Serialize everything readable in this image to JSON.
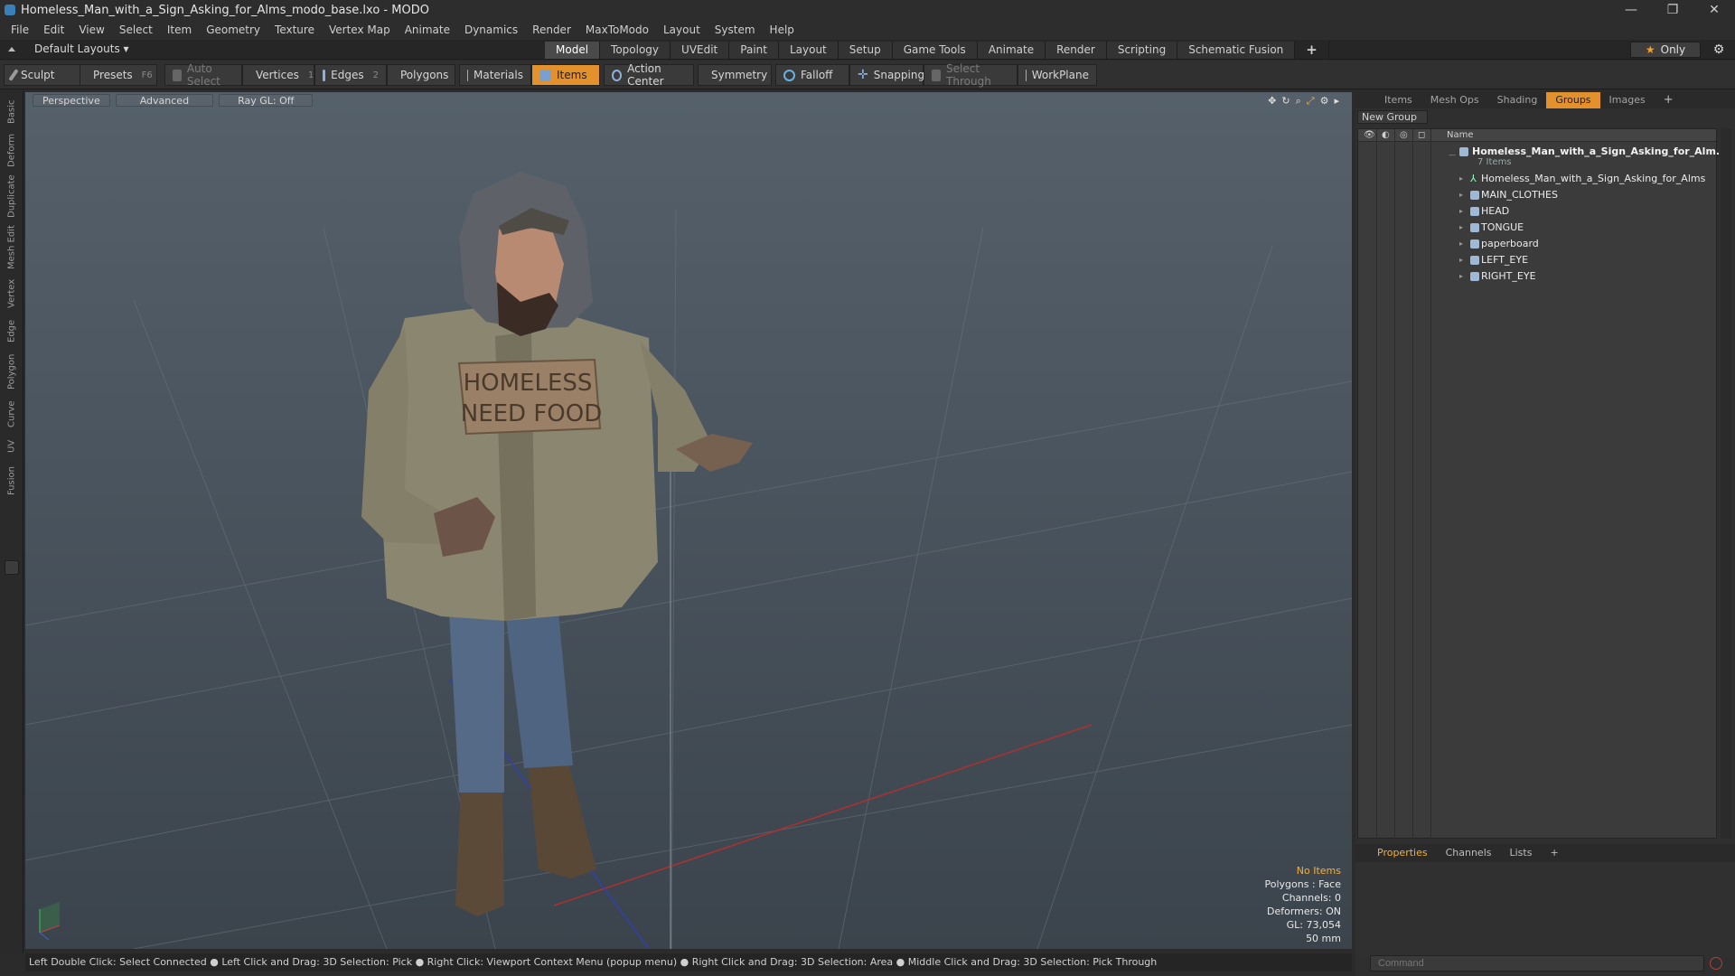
{
  "window": {
    "title": "Homeless_Man_with_a_Sign_Asking_for_Alms_modo_base.lxo - MODO",
    "controls": [
      "—",
      "❐",
      "✕"
    ]
  },
  "menu": [
    "File",
    "Edit",
    "View",
    "Select",
    "Item",
    "Geometry",
    "Texture",
    "Vertex Map",
    "Animate",
    "Dynamics",
    "Render",
    "MaxToModo",
    "Layout",
    "System",
    "Help"
  ],
  "layout_bar": {
    "layout_select": "Default Layouts ▾",
    "tabs": [
      "Model",
      "Topology",
      "UVEdit",
      "Paint",
      "Layout",
      "Setup",
      "Game Tools",
      "Animate",
      "Render",
      "Scripting",
      "Schematic Fusion"
    ],
    "active_tab": "Model",
    "add_tab": "+",
    "only_label": "Only",
    "star": "★"
  },
  "toolbar": {
    "sculpt": "Sculpt",
    "presets": "Presets",
    "presets_key": "F6",
    "auto_select": "Auto Select",
    "vertices": "Vertices",
    "vertices_key": "1",
    "edges": "Edges",
    "edges_key": "2",
    "polygons": "Polygons",
    "materials": "Materials",
    "items": "Items",
    "action_center": "Action Center",
    "symmetry": "Symmetry",
    "falloff": "Falloff",
    "snapping": "Snapping",
    "select_through": "Select Through",
    "workplane": "WorkPlane"
  },
  "left_strip": [
    "Basic",
    "Deform",
    "Duplicate",
    "Mesh Edit",
    "Vertex",
    "Edge",
    "Polygon",
    "Curve",
    "UV",
    "Fusion"
  ],
  "viewport": {
    "view_mode": "Perspective",
    "shading": "Advanced",
    "raygl": "Ray GL: Off",
    "sign_line1": "HOMELESS",
    "sign_line2": "NEED FOOD",
    "stats": {
      "selection": "No Items",
      "polygons": "Polygons : Face",
      "channels": "Channels: 0",
      "deformers": "Deformers: ON",
      "gl": "GL: 73,054",
      "focal": "50 mm"
    }
  },
  "status_bar": "Left Double Click: Select Connected ● Left Click and Drag: 3D Selection: Pick ● Right Click: Viewport Context Menu (popup menu) ● Right Click and Drag: 3D Selection: Area ● Middle Click and Drag: 3D Selection: Pick Through",
  "right_panel": {
    "tabs": [
      "Items",
      "Mesh Ops",
      "Shading",
      "Groups",
      "Images"
    ],
    "active_tab": "Groups",
    "add_tab": "+",
    "new_group": "New Group",
    "column_name": "Name",
    "root": {
      "label": "Homeless_Man_with_a_Sign_Asking_for_Alm...",
      "count": "7 Items"
    },
    "items": [
      "Homeless_Man_with_a_Sign_Asking_for_Alms",
      "MAIN_CLOTHES",
      "HEAD",
      "TONGUE",
      "paperboard",
      "LEFT_EYE",
      "RIGHT_EYE"
    ]
  },
  "properties": {
    "tabs": [
      "Properties",
      "Channels",
      "Lists"
    ],
    "active_tab": "Properties",
    "add_tab": "+",
    "command_placeholder": "Command"
  },
  "colors": {
    "accent_orange": "#e3912c",
    "highlight_text": "#f0b040",
    "viewport_top": "#55606a",
    "viewport_bottom": "#3b444c"
  }
}
